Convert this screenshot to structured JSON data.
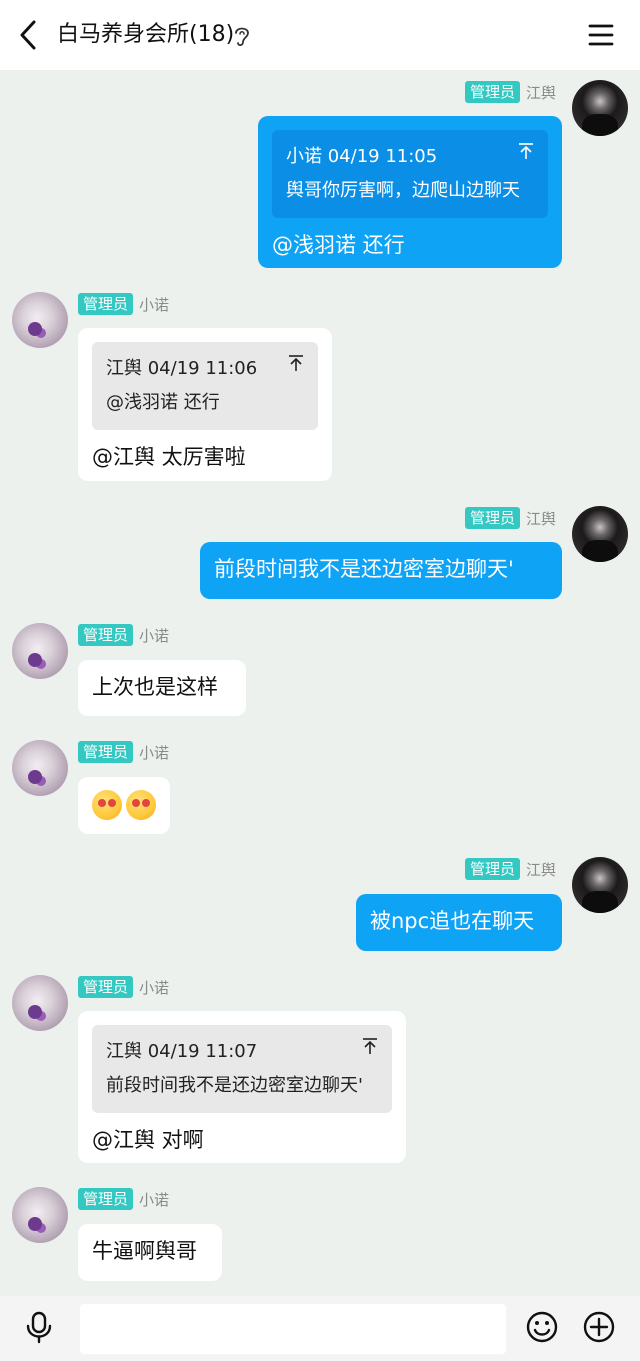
{
  "header": {
    "title": "白马养身会所(18)",
    "back_icon": "chevron-left-icon",
    "ear_icon": "ear-icon",
    "menu_icon": "hamburger-menu-icon"
  },
  "messages": [
    {
      "side": "right",
      "badge": "管理员",
      "nick": "江舆",
      "quote": {
        "head": "小诺 04/19 11:05",
        "text": "舆哥你厉害啊，边爬山边聊天"
      },
      "text": "@浅羽诺 还行"
    },
    {
      "side": "left",
      "badge": "管理员",
      "nick": "小诺",
      "quote": {
        "head": "江舆 04/19 11:06",
        "text": "@浅羽诺 还行"
      },
      "text": "@江舆 太厉害啦"
    },
    {
      "side": "right",
      "badge": "管理员",
      "nick": "江舆",
      "text": "前段时间我不是还边密室边聊天'"
    },
    {
      "side": "left",
      "badge": "管理员",
      "nick": "小诺",
      "text": "上次也是这样"
    },
    {
      "side": "left",
      "badge": "管理员",
      "nick": "小诺",
      "emoji": [
        "hugging-face-emoji",
        "hugging-face-emoji"
      ]
    },
    {
      "side": "right",
      "badge": "管理员",
      "nick": "江舆",
      "text": "被npc追也在聊天"
    },
    {
      "side": "left",
      "badge": "管理员",
      "nick": "小诺",
      "quote": {
        "head": "江舆 04/19 11:07",
        "text": "前段时间我不是还边密室边聊天'"
      },
      "text": "@江舆 对啊"
    },
    {
      "side": "left",
      "badge": "管理员",
      "nick": "小诺",
      "text": "牛逼啊舆哥"
    }
  ],
  "bottom": {
    "input_value": "",
    "input_placeholder": "",
    "mic_icon": "microphone-icon",
    "emoji_icon": "smiley-icon",
    "plus_icon": "plus-circle-icon"
  },
  "colors": {
    "background": "#edf1ee",
    "bubble_blue": "#0fa3f6",
    "badge": "#33c8c1"
  }
}
